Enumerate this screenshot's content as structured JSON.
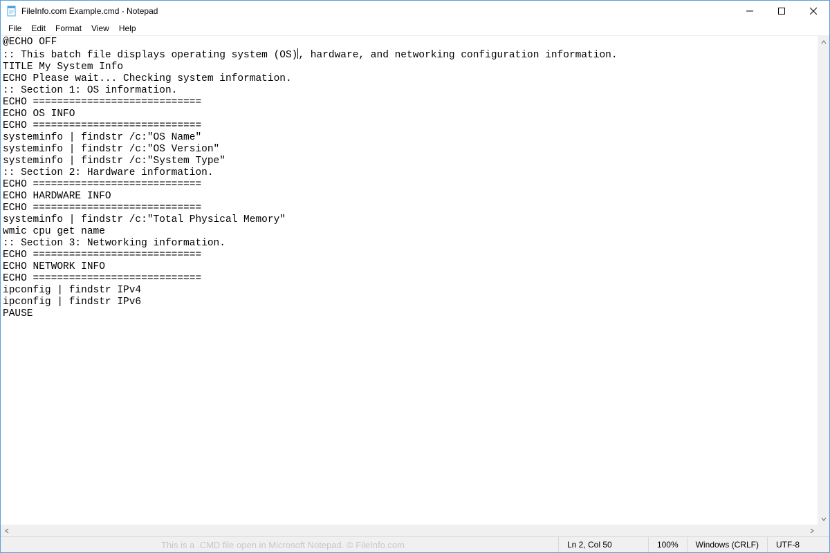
{
  "titlebar": {
    "title": "FileInfo.com Example.cmd - Notepad"
  },
  "menu": {
    "file": "File",
    "edit": "Edit",
    "format": "Format",
    "view": "View",
    "help": "Help"
  },
  "editor": {
    "line1": "@ECHO OFF",
    "line2a": ":: This batch file displays operating system (OS)",
    "line2b": ", hardware, and networking configuration information.",
    "line3": "TITLE My System Info",
    "line4": "ECHO Please wait... Checking system information.",
    "line5": ":: Section 1: OS information.",
    "line6": "ECHO ============================",
    "line7": "ECHO OS INFO",
    "line8": "ECHO ============================",
    "line9": "systeminfo | findstr /c:\"OS Name\"",
    "line10": "systeminfo | findstr /c:\"OS Version\"",
    "line11": "systeminfo | findstr /c:\"System Type\"",
    "line12": ":: Section 2: Hardware information.",
    "line13": "ECHO ============================",
    "line14": "ECHO HARDWARE INFO",
    "line15": "ECHO ============================",
    "line16": "systeminfo | findstr /c:\"Total Physical Memory\"",
    "line17": "wmic cpu get name",
    "line18": ":: Section 3: Networking information.",
    "line19": "ECHO ============================",
    "line20": "ECHO NETWORK INFO",
    "line21": "ECHO ============================",
    "line22": "ipconfig | findstr IPv4",
    "line23": "ipconfig | findstr IPv6",
    "line24": "PAUSE"
  },
  "status": {
    "watermark": "This is a .CMD file open in Microsoft Notepad. © FileInfo.com",
    "position": "Ln 2, Col 50",
    "zoom": "100%",
    "eol": "Windows (CRLF)",
    "encoding": "UTF-8"
  }
}
